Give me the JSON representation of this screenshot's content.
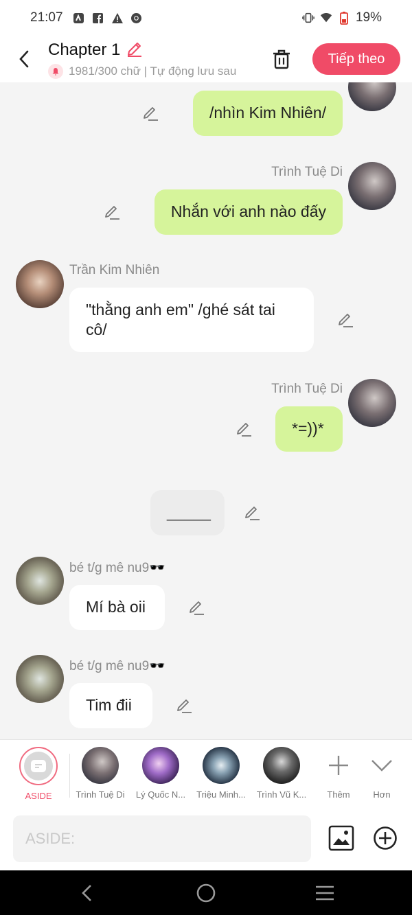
{
  "status": {
    "time": "21:07",
    "battery": "19%",
    "icons": [
      "notification-icon",
      "facebook-icon",
      "warning-icon",
      "chrome-icon",
      "vibrate-icon",
      "wifi-icon",
      "battery-icon"
    ]
  },
  "header": {
    "title": "Chapter 1",
    "subtitle": "1981/300 chữ | Tự động lưu sau",
    "next_label": "Tiếp theo"
  },
  "messages": [
    {
      "type": "me",
      "name": "",
      "text": "/nhìn Kim Nhiên/"
    },
    {
      "type": "me",
      "name": "Trình Tuệ Di",
      "text": "Nhắn với anh nào đấy"
    },
    {
      "type": "them",
      "name": "Trần Kim Nhiên",
      "text": "\"thằng anh em\" /ghé sát tai cô/"
    },
    {
      "type": "me",
      "name": "Trình Tuệ Di",
      "text": "*=))*"
    },
    {
      "type": "narration",
      "name": "",
      "text": "_____"
    },
    {
      "type": "them",
      "name": "bé t/g mê nu9🕶️",
      "text": "Mí bà oii"
    },
    {
      "type": "them",
      "name": "bé t/g mê nu9🕶️",
      "text": "Tim đii"
    }
  ],
  "characters": [
    {
      "label": "ASIDE"
    },
    {
      "label": "Trình Tuệ Di"
    },
    {
      "label": "Lý Quốc N..."
    },
    {
      "label": "Triệu Minh..."
    },
    {
      "label": "Trình Vũ K..."
    },
    {
      "label": "Thêm"
    },
    {
      "label": "Hơn"
    }
  ],
  "input": {
    "placeholder": "ASIDE:"
  },
  "colors": {
    "accent": "#f04b67",
    "my_bubble": "#d6f49b",
    "their_bubble": "#ffffff"
  }
}
